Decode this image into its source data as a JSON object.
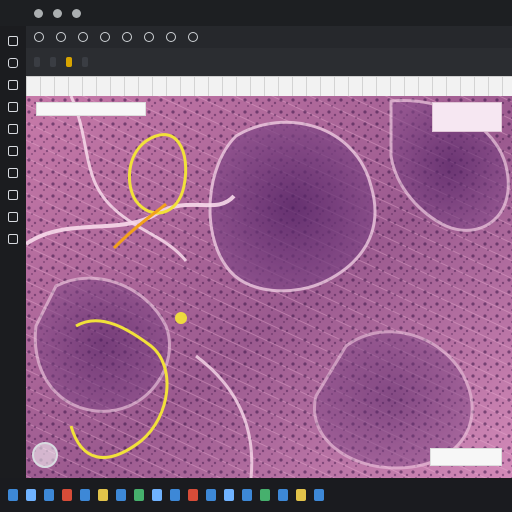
{
  "window": {
    "title": ""
  },
  "toolbar": {
    "items": [
      {
        "label": ""
      },
      {
        "label": ""
      },
      {
        "label": ""
      },
      {
        "label": ""
      }
    ]
  },
  "viewer": {
    "top_label": "",
    "minimap_label": "",
    "scale_label": ""
  },
  "colors": {
    "annotation_yellow": "#f1e13a",
    "annotation_orange": "#f2a11a",
    "tissue_pink": "#cf7bb0",
    "tissue_purple": "#5d2b73"
  }
}
